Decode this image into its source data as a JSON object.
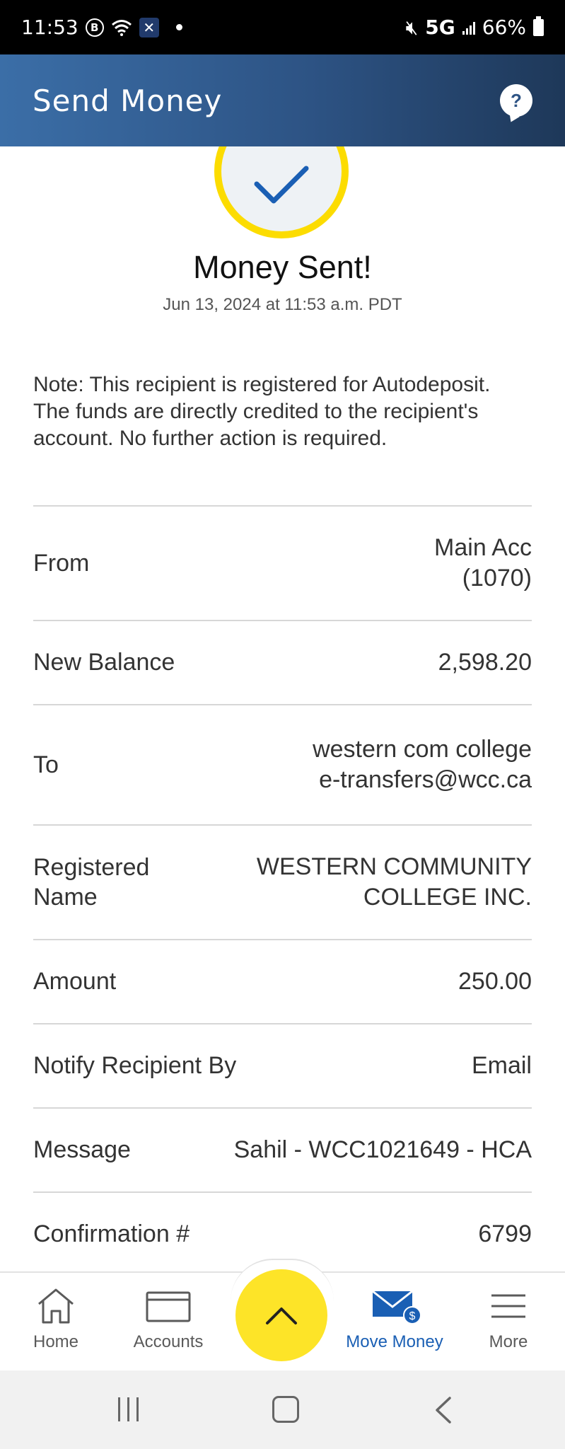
{
  "status_bar": {
    "time": "11:53",
    "b_icon_text": "B",
    "network": "5G",
    "battery": "66%"
  },
  "header": {
    "title": "Send Money",
    "help_label": "?"
  },
  "confirmation": {
    "title": "Money Sent!",
    "date": "Jun 13, 2024 at 11:53 a.m. PDT",
    "note": "Note: This recipient is registered for Autodeposit. The funds are directly credited to the recipient's account. No further action is required."
  },
  "details": {
    "from": {
      "label": "From",
      "value_line1": "Main Acc",
      "value_line2": "(1070)"
    },
    "new_balance": {
      "label": "New Balance",
      "value": "2,598.20"
    },
    "to": {
      "label": "To",
      "value_line1": "western com college",
      "value_line2": "e-transfers@wcc.ca"
    },
    "registered_name": {
      "label_line1": "Registered",
      "label_line2": "Name",
      "value_line1": "WESTERN COMMUNITY",
      "value_line2": "COLLEGE INC."
    },
    "amount": {
      "label": "Amount",
      "value": "250.00"
    },
    "notify": {
      "label": "Notify Recipient By",
      "value": "Email"
    },
    "message": {
      "label": "Message",
      "value": "Sahil - WCC1021649 - HCA"
    },
    "confirmation_number": {
      "label": "Confirmation #",
      "value": "6799"
    }
  },
  "bottom_nav": {
    "items": [
      {
        "label": "Home",
        "icon": "home-icon"
      },
      {
        "label": "Accounts",
        "icon": "card-icon"
      },
      {
        "label": "Move Money",
        "icon": "envelope-dollar-icon",
        "active": true
      },
      {
        "label": "More",
        "icon": "hamburger-icon"
      }
    ],
    "fab_icon": "chevron-up-icon"
  },
  "colors": {
    "header_start": "#3b6ea7",
    "header_end": "#1e3859",
    "accent_yellow": "#fcdc00",
    "active_blue": "#1a5fb4",
    "check_blue": "#1a5fb4"
  }
}
